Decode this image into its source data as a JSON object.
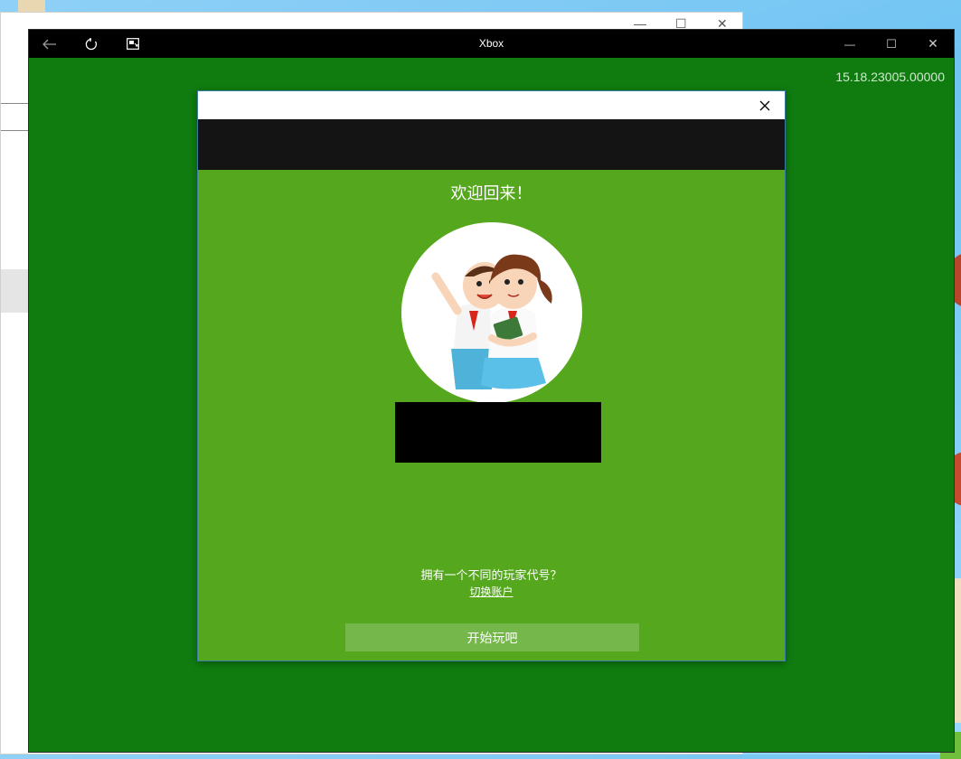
{
  "background_window": {
    "controls": [
      "—",
      "☐",
      "✕"
    ]
  },
  "xbox_window": {
    "title": "Xbox",
    "back_icon": "back-arrow-icon",
    "refresh_icon": "refresh-icon",
    "snap_icon": "snap-icon",
    "minimize": "—",
    "maximize": "☐",
    "close": "✕",
    "version": "15.18.23005.00000",
    "accent_color": "#107c10"
  },
  "dialog": {
    "close_icon": "close-icon",
    "welcome": "欢迎回来！",
    "question": "拥有一个不同的玩家代号？",
    "switch_account": "切换账户",
    "start_button": "开始玩吧",
    "dialog_color": "#55a81d"
  }
}
